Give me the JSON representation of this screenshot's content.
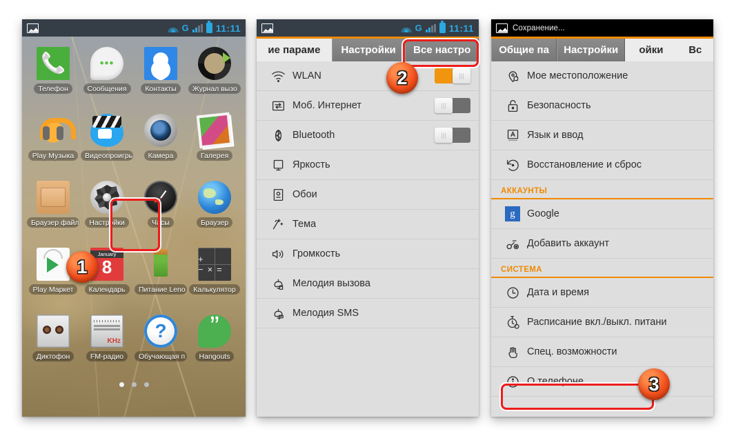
{
  "statusbar": {
    "time": "11:11",
    "network_label": "G",
    "saving_text": "Сохранение...",
    "icons": [
      "photo-icon",
      "wifi-icon",
      "signal-icon",
      "battery-icon"
    ]
  },
  "colors": {
    "accent_orange": "#f08a00",
    "toggle_on": "#f0950d",
    "highlight_red": "#ee1c1c",
    "status_cyan": "#2aa8e0",
    "panel_bg": "#dedede"
  },
  "home": {
    "rows": [
      [
        {
          "label": "Телефон",
          "icon": "phone-app-icon",
          "art": "a-phone"
        },
        {
          "label": "Сообщения",
          "icon": "messages-app-icon",
          "art": "a-sms"
        },
        {
          "label": "Контакты",
          "icon": "contacts-app-icon",
          "art": "a-contacts"
        },
        {
          "label": "Журнал вызо",
          "icon": "call-log-app-icon",
          "art": "a-calllog"
        }
      ],
      [
        {
          "label": "Play Музыка",
          "icon": "play-music-app-icon",
          "art": "a-music"
        },
        {
          "label": "Видеопроигрь",
          "icon": "video-player-app-icon",
          "art": "a-video"
        },
        {
          "label": "Камера",
          "icon": "camera-app-icon",
          "art": "a-camera"
        },
        {
          "label": "Галерея",
          "icon": "gallery-app-icon",
          "art": "a-gallery"
        }
      ],
      [
        {
          "label": "Браузер файл",
          "icon": "file-browser-app-icon",
          "art": "a-filebrowser"
        },
        {
          "label": "Настройки",
          "icon": "settings-app-icon",
          "art": "a-settings"
        },
        {
          "label": "Часы",
          "icon": "clock-app-icon",
          "art": "a-clock"
        },
        {
          "label": "Браузер",
          "icon": "browser-app-icon",
          "art": "a-browser"
        }
      ],
      [
        {
          "label": "Play Маркет",
          "icon": "play-store-app-icon",
          "art": "a-play"
        },
        {
          "label": "Календарь",
          "icon": "calendar-app-icon",
          "art": "a-cal"
        },
        {
          "label": "Питание Leno",
          "icon": "power-manager-app-icon",
          "art": "a-battery"
        },
        {
          "label": "Калькулятор",
          "icon": "calculator-app-icon",
          "art": "a-calc"
        }
      ],
      [
        {
          "label": "Диктофон",
          "icon": "voice-recorder-app-icon",
          "art": "a-recorder"
        },
        {
          "label": "FM-радио",
          "icon": "fm-radio-app-icon",
          "art": "a-fm"
        },
        {
          "label": "Обучающая п",
          "icon": "tutorial-app-icon",
          "art": "a-learn"
        },
        {
          "label": "Hangouts",
          "icon": "hangouts-app-icon",
          "art": "a-hangouts"
        }
      ]
    ],
    "page_dots": 3,
    "active_dot": 0
  },
  "quick_settings": {
    "tabs": [
      {
        "label": "ие параме",
        "state": "light"
      },
      {
        "label": "Настройки",
        "state": "dark"
      },
      {
        "label": "Все настро",
        "state": "dark"
      }
    ],
    "items": [
      {
        "label": "WLAN",
        "icon": "wifi-icon",
        "glyph": "὏6",
        "toggle": "on"
      },
      {
        "label": "Моб. Интернет",
        "icon": "mobile-data-icon",
        "glyph": "⇄",
        "toggle": "off"
      },
      {
        "label": "Bluetooth",
        "icon": "bluetooth-icon",
        "glyph": "Ƀ",
        "toggle": "off"
      },
      {
        "label": "Яркость",
        "icon": "brightness-icon",
        "glyph": "□",
        "toggle": "none"
      },
      {
        "label": "Обои",
        "icon": "wallpaper-icon",
        "glyph": "▣",
        "toggle": "none"
      },
      {
        "label": "Тема",
        "icon": "theme-icon",
        "glyph": "✳",
        "toggle": "none"
      },
      {
        "label": "Громкость",
        "icon": "volume-icon",
        "glyph": "ὐA",
        "toggle": "none"
      },
      {
        "label": "Мелодия вызова",
        "icon": "ringtone-icon",
        "glyph": "ὑ4",
        "toggle": "none"
      },
      {
        "label": "Мелодия SMS",
        "icon": "sms-tone-icon",
        "glyph": "ὑ4",
        "toggle": "none"
      }
    ]
  },
  "all_settings": {
    "tabs": [
      {
        "label": "Общие па",
        "state": "dark"
      },
      {
        "label": "Настройки",
        "state": "dark"
      },
      {
        "label": "ойки",
        "state": "plain"
      },
      {
        "label": "Вс",
        "state": "plain"
      }
    ],
    "items": [
      {
        "kind": "item",
        "label": "Мое местоположение",
        "icon": "location-icon",
        "glyph": "◎"
      },
      {
        "kind": "item",
        "label": "Безопасность",
        "icon": "security-lock-icon",
        "glyph": "ὑ2"
      },
      {
        "kind": "item",
        "label": "Язык и ввод",
        "icon": "language-input-icon",
        "glyph": "ὒ4"
      },
      {
        "kind": "item",
        "label": "Восстановление и сброс",
        "icon": "backup-reset-icon",
        "glyph": "↺"
      },
      {
        "kind": "section",
        "label": "АККАУНТЫ"
      },
      {
        "kind": "item",
        "label": "Google",
        "icon": "google-icon",
        "glyph": "g"
      },
      {
        "kind": "item",
        "label": "Добавить аккаунт",
        "icon": "add-account-icon",
        "glyph": "⚯"
      },
      {
        "kind": "section",
        "label": "СИСТЕМА"
      },
      {
        "kind": "item",
        "label": "Дата и время",
        "icon": "clock-icon",
        "glyph": "ὕ0"
      },
      {
        "kind": "item",
        "label": "Расписание вкл./выкл. питани",
        "icon": "power-schedule-icon",
        "glyph": "⏱"
      },
      {
        "kind": "item",
        "label": "Спец. возможности",
        "icon": "accessibility-hand-icon",
        "glyph": "✋"
      },
      {
        "kind": "item",
        "label": "О телефоне",
        "icon": "about-phone-icon",
        "glyph": "ⓘ"
      }
    ]
  },
  "annotations": {
    "steps": [
      {
        "number": "1",
        "target": "settings-app-icon"
      },
      {
        "number": "2",
        "target": "tab-all-settings"
      },
      {
        "number": "3",
        "target": "about-phone-row"
      }
    ]
  }
}
